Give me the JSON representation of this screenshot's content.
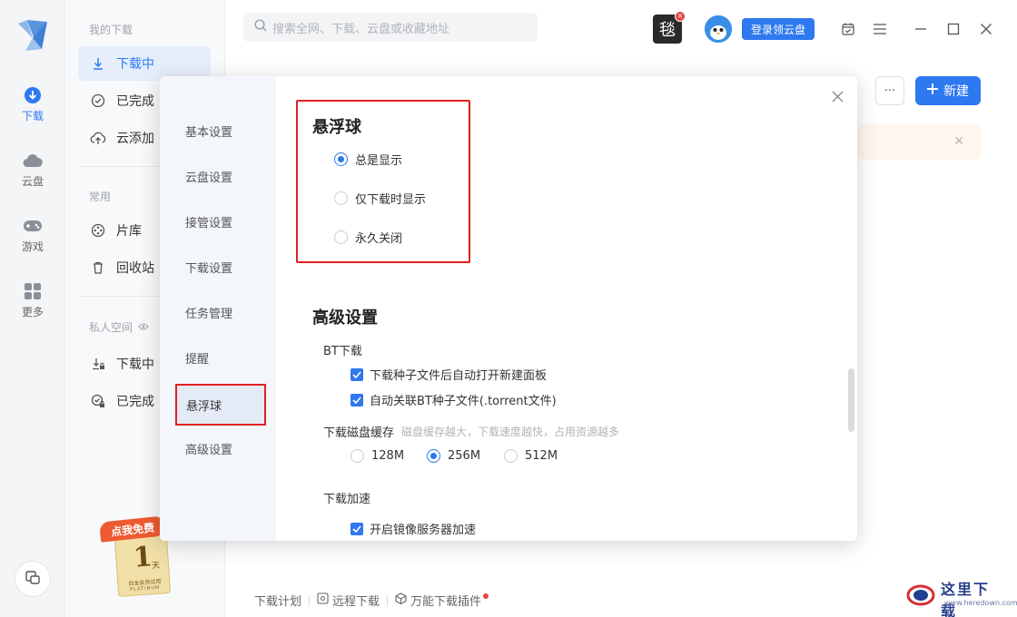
{
  "rail": {
    "items": [
      {
        "label": "下载",
        "icon": "download-circle-icon"
      },
      {
        "label": "云盘",
        "icon": "cloud-icon"
      },
      {
        "label": "游戏",
        "icon": "gamepad-icon"
      },
      {
        "label": "更多",
        "icon": "grid-icon"
      }
    ]
  },
  "nav": {
    "my_downloads": "我的下载",
    "downloading": "下载中",
    "completed": "已完成",
    "cloud_add": "云添加",
    "common": "常用",
    "library": "片库",
    "recycle": "回收站",
    "private_space": "私人空间",
    "private_downloading": "下载中",
    "private_completed": "已完成"
  },
  "promo": {
    "text": "点我免费",
    "days": "1",
    "unit": "天",
    "sub": "白金会员试用",
    "sub2": "PLATINUM"
  },
  "topbar": {
    "search_placeholder": "搜索全网、下载、云盘或收藏地址",
    "avatar_text": "毯",
    "login_label": "登录领云盘"
  },
  "toolbar": {
    "more_label": "···",
    "new_label": "新建"
  },
  "bottom": {
    "plan": "下载计划",
    "remote": "远程下载",
    "plugin": "万能下载插件"
  },
  "modal": {
    "menu": [
      "基本设置",
      "云盘设置",
      "接管设置",
      "下载设置",
      "任务管理",
      "提醒",
      "悬浮球",
      "高级设置"
    ],
    "active_index": 6,
    "float_ball": {
      "title": "悬浮球",
      "options": [
        "总是显示",
        "仅下载时显示",
        "永久关闭"
      ],
      "selected": 0
    },
    "advanced": {
      "title": "高级设置",
      "bt_label": "BT下载",
      "bt_opt1": "下载种子文件后自动打开新建面板",
      "bt_opt2": "自动关联BT种子文件(.torrent文件)",
      "cache_label": "下载磁盘缓存",
      "cache_hint": "磁盘缓存越大，下载速度越快，占用资源越多",
      "cache_options": [
        "128M",
        "256M",
        "512M"
      ],
      "cache_selected": 1,
      "accel_label": "下载加速",
      "accel_opt1": "开启镜像服务器加速"
    }
  },
  "watermark": {
    "title": "这里下载",
    "url": "www.heredown.com"
  },
  "colors": {
    "accent": "#2e78f0",
    "highlight": "#e02020"
  }
}
